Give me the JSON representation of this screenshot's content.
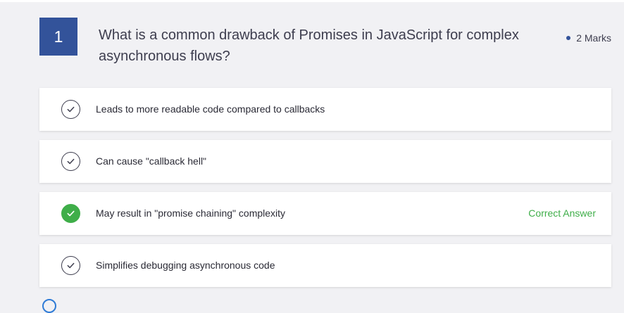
{
  "question": {
    "number": "1",
    "text": "What is a common drawback of Promises in JavaScript for complex asynchronous flows?",
    "marks": "2 Marks"
  },
  "options": [
    {
      "label": "Leads to more readable code compared to callbacks",
      "correct": false
    },
    {
      "label": "Can cause \"callback hell\"",
      "correct": false
    },
    {
      "label": "May result in \"promise chaining\" complexity",
      "correct": true,
      "tag": "Correct Answer"
    },
    {
      "label": "Simplifies debugging asynchronous code",
      "correct": false
    }
  ],
  "colors": {
    "accent": "#33539a",
    "correct": "#3fae49",
    "background": "#f1f1f4"
  },
  "icons": {
    "option_check": "check-circle-icon",
    "correct_check": "check-circle-filled-icon"
  }
}
